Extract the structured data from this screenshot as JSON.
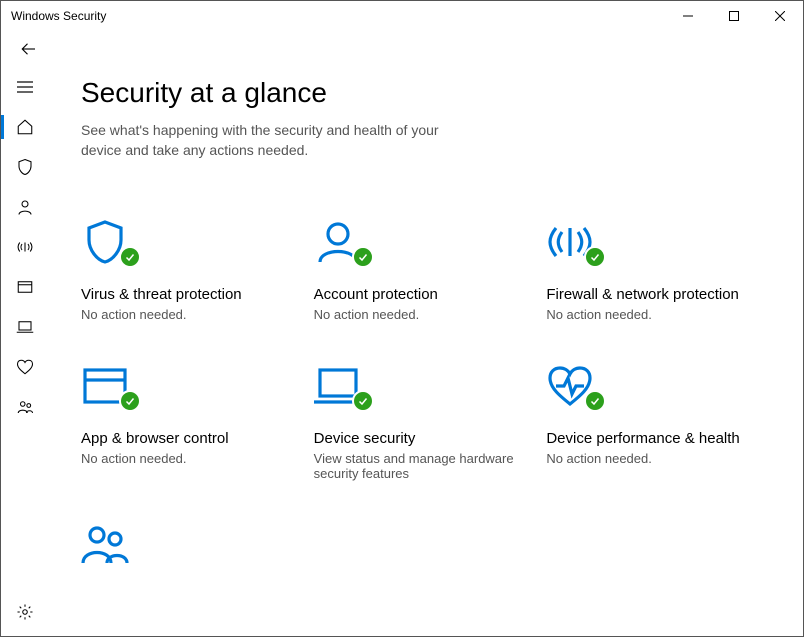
{
  "window": {
    "title": "Windows Security"
  },
  "page": {
    "heading": "Security at a glance",
    "subheading": "See what's happening with the security and health of your device and take any actions needed."
  },
  "tiles": [
    {
      "title": "Virus & threat protection",
      "status": "No action needed."
    },
    {
      "title": "Account protection",
      "status": "No action needed."
    },
    {
      "title": "Firewall & network protection",
      "status": "No action needed."
    },
    {
      "title": "App & browser control",
      "status": "No action needed."
    },
    {
      "title": "Device security",
      "status": "View status and manage hardware security features"
    },
    {
      "title": "Device performance & health",
      "status": "No action needed."
    }
  ],
  "colors": {
    "accent": "#0078d7",
    "ok": "#2ca01c",
    "text_muted": "#555"
  }
}
